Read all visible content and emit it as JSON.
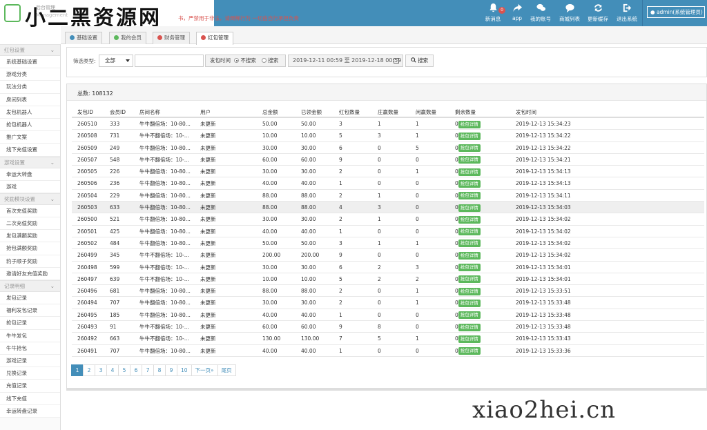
{
  "header": {
    "logo_title": "小二黑资源网",
    "logo_sub": "后台管理",
    "logo_sub2": "Management",
    "notice": "书，严禁用于非法，请倒稀行为 一切由自行承担负责",
    "nav": [
      {
        "label": "新消息",
        "icon": "bell-icon",
        "badge": "0"
      },
      {
        "label": "app",
        "icon": "share-icon"
      },
      {
        "label": "我的账号",
        "icon": "chat-icon"
      },
      {
        "label": "商城列表",
        "icon": "comments-icon"
      },
      {
        "label": "更新缓存",
        "icon": "refresh-icon"
      },
      {
        "label": "退出系统",
        "icon": "logout-icon"
      }
    ],
    "user": "admin(系统管理员)"
  },
  "tabs": [
    {
      "label": "基础设置",
      "icon": "gear-icon",
      "color": "#438eb9"
    },
    {
      "label": "我的会员",
      "icon": "user-icon",
      "color": "#5cb85c"
    },
    {
      "label": "财务管理",
      "icon": "money-icon",
      "color": "#d9534f"
    },
    {
      "label": "红包管理",
      "icon": "redpacket-icon",
      "color": "#d9534f"
    }
  ],
  "sidebar": [
    {
      "group": "红包设置",
      "items": [
        "系统基础设置",
        "游戏分类",
        "玩法分类",
        "房间列表",
        "发包机器人",
        "抢包机器人",
        "推广文案",
        "线下充值设置"
      ]
    },
    {
      "group": "游戏设置",
      "items": [
        "幸运大转盘",
        "游戏"
      ]
    },
    {
      "group": "奖励模块设置",
      "items": [
        "首次充值奖励",
        "二次充值奖励",
        "发包满额奖励",
        "抢包满额奖励",
        "豹子顺子奖励",
        "邀请好友充值奖励"
      ]
    },
    {
      "group": "记录明细",
      "items": [
        "发包记录",
        "福利发包记录",
        "抢包记录",
        "牛牛发包",
        "牛牛抢包",
        "游戏记录",
        "兑换记录",
        "充值记录",
        "线下充值",
        "幸运转盘记录"
      ]
    }
  ],
  "filter": {
    "label": "筛选类型:",
    "type_value": "全部",
    "search_value": "",
    "time_label": "发包时间",
    "radio_no": "不搜索",
    "radio_yes": "搜索",
    "date_range": "2019-12-11 00:59 至 2019-12-18 00:59",
    "search_button": "搜索"
  },
  "total": "总数: 108132",
  "table": {
    "headers": [
      "发包ID",
      "会员ID",
      "房间名称",
      "用户",
      "总金额",
      "已领金额",
      "红包数量",
      "庄赢数量",
      "闲赢数量",
      "剩余数量",
      "发包时间"
    ],
    "detail_label": "抢包详情",
    "rows": [
      [
        "260510",
        "333",
        "牛牛翻倍场：10-80...",
        "未更新",
        "50.00",
        "50.00",
        "3",
        "1",
        "1",
        "0",
        "2019-12-13 15:34:23"
      ],
      [
        "260508",
        "731",
        "牛牛不翻倍场：10-...",
        "未更新",
        "10.00",
        "10.00",
        "5",
        "3",
        "1",
        "0",
        "2019-12-13 15:34:22"
      ],
      [
        "260509",
        "249",
        "牛牛翻倍场：10-80...",
        "未更新",
        "30.00",
        "30.00",
        "6",
        "0",
        "5",
        "0",
        "2019-12-13 15:34:22"
      ],
      [
        "260507",
        "548",
        "牛牛不翻倍场：10-...",
        "未更新",
        "60.00",
        "60.00",
        "9",
        "0",
        "0",
        "0",
        "2019-12-13 15:34:21"
      ],
      [
        "260505",
        "226",
        "牛牛翻倍场：10-80...",
        "未更新",
        "30.00",
        "30.00",
        "2",
        "0",
        "1",
        "0",
        "2019-12-13 15:34:13"
      ],
      [
        "260506",
        "236",
        "牛牛翻倍场：10-80...",
        "未更新",
        "40.00",
        "40.00",
        "1",
        "0",
        "0",
        "0",
        "2019-12-13 15:34:13"
      ],
      [
        "260504",
        "229",
        "牛牛翻倍场：10-80...",
        "未更新",
        "88.00",
        "88.00",
        "2",
        "1",
        "0",
        "0",
        "2019-12-13 15:34:11"
      ],
      [
        "260503",
        "633",
        "牛牛翻倍场：10-80...",
        "未更新",
        "88.00",
        "88.00",
        "4",
        "3",
        "0",
        "0",
        "2019-12-13 15:34:03"
      ],
      [
        "260500",
        "521",
        "牛牛翻倍场：10-80...",
        "未更新",
        "30.00",
        "30.00",
        "2",
        "1",
        "0",
        "0",
        "2019-12-13 15:34:02"
      ],
      [
        "260501",
        "425",
        "牛牛翻倍场：10-80...",
        "未更新",
        "40.00",
        "40.00",
        "1",
        "0",
        "0",
        "0",
        "2019-12-13 15:34:02"
      ],
      [
        "260502",
        "484",
        "牛牛翻倍场：10-80...",
        "未更新",
        "50.00",
        "50.00",
        "3",
        "1",
        "1",
        "0",
        "2019-12-13 15:34:02"
      ],
      [
        "260499",
        "345",
        "牛牛不翻倍场：10-...",
        "未更新",
        "200.00",
        "200.00",
        "9",
        "0",
        "0",
        "0",
        "2019-12-13 15:34:02"
      ],
      [
        "260498",
        "599",
        "牛牛不翻倍场：10-...",
        "未更新",
        "30.00",
        "30.00",
        "6",
        "2",
        "3",
        "0",
        "2019-12-13 15:34:01"
      ],
      [
        "260497",
        "639",
        "牛牛不翻倍场：10-...",
        "未更新",
        "10.00",
        "10.00",
        "5",
        "2",
        "2",
        "0",
        "2019-12-13 15:34:01"
      ],
      [
        "260496",
        "681",
        "牛牛翻倍场：10-80...",
        "未更新",
        "88.00",
        "88.00",
        "2",
        "0",
        "1",
        "0",
        "2019-12-13 15:33:51"
      ],
      [
        "260494",
        "707",
        "牛牛翻倍场：10-80...",
        "未更新",
        "30.00",
        "30.00",
        "2",
        "0",
        "1",
        "0",
        "2019-12-13 15:33:48"
      ],
      [
        "260495",
        "185",
        "牛牛翻倍场：10-80...",
        "未更新",
        "40.00",
        "40.00",
        "1",
        "0",
        "0",
        "0",
        "2019-12-13 15:33:48"
      ],
      [
        "260493",
        "91",
        "牛牛不翻倍场：10-...",
        "未更新",
        "60.00",
        "60.00",
        "9",
        "8",
        "0",
        "0",
        "2019-12-13 15:33:48"
      ],
      [
        "260492",
        "663",
        "牛牛不翻倍场：10-...",
        "未更新",
        "130.00",
        "130.00",
        "7",
        "5",
        "1",
        "0",
        "2019-12-13 15:33:43"
      ],
      [
        "260491",
        "707",
        "牛牛翻倍场：10-80...",
        "未更新",
        "40.00",
        "40.00",
        "1",
        "0",
        "0",
        "0",
        "2019-12-13 15:33:36"
      ]
    ]
  },
  "pager": [
    "1",
    "2",
    "3",
    "4",
    "5",
    "6",
    "7",
    "8",
    "9",
    "10",
    "下一页»",
    "尾页"
  ],
  "watermark": "xiao2hei.cn"
}
